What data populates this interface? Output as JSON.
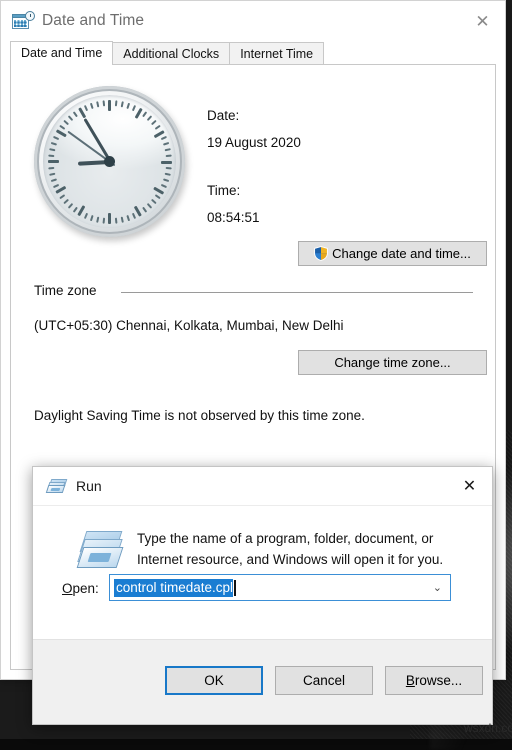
{
  "desktop": {
    "watermark": "wsxdn.co"
  },
  "main_window": {
    "title": "Date and Time",
    "icon": "date-time-calendar-clock-icon",
    "close_label": "✕",
    "tabs": [
      {
        "label": "Date and Time",
        "active": true
      },
      {
        "label": "Additional Clocks",
        "active": false
      },
      {
        "label": "Internet Time",
        "active": false
      }
    ],
    "clock": {
      "icon": "analog-clock",
      "hour": 8,
      "minute": 54,
      "second": 51
    },
    "date_label": "Date:",
    "date_value": "19 August 2020",
    "time_label": "Time:",
    "time_value": "08:54:51",
    "change_datetime_button": "Change date and time...",
    "shield_icon": "uac-shield-icon",
    "timezone_group_label": "Time zone",
    "timezone_value": "(UTC+05:30) Chennai, Kolkata, Mumbai, New Delhi",
    "change_timezone_button": "Change time zone...",
    "dst_note": "Daylight Saving Time is not observed by this time zone."
  },
  "run_dialog": {
    "title": "Run",
    "icon": "run-window-icon",
    "close_label": "✕",
    "description": "Type the name of a program, folder, document, or Internet resource, and Windows will open it for you.",
    "open_label_prefix": "O",
    "open_label_rest": "pen:",
    "open_value": "control timedate.cpl",
    "open_placeholder": "",
    "combo_arrow": "⌄",
    "buttons": {
      "ok": "OK",
      "cancel": "Cancel",
      "browse_prefix": "B",
      "browse_rest": "rowse..."
    }
  },
  "colors": {
    "accent_blue": "#1878c8",
    "selection_blue": "#1a7dd2",
    "button_face": "#e1e1e1",
    "button_border": "#adadad",
    "window_border": "#c8c8c8"
  }
}
